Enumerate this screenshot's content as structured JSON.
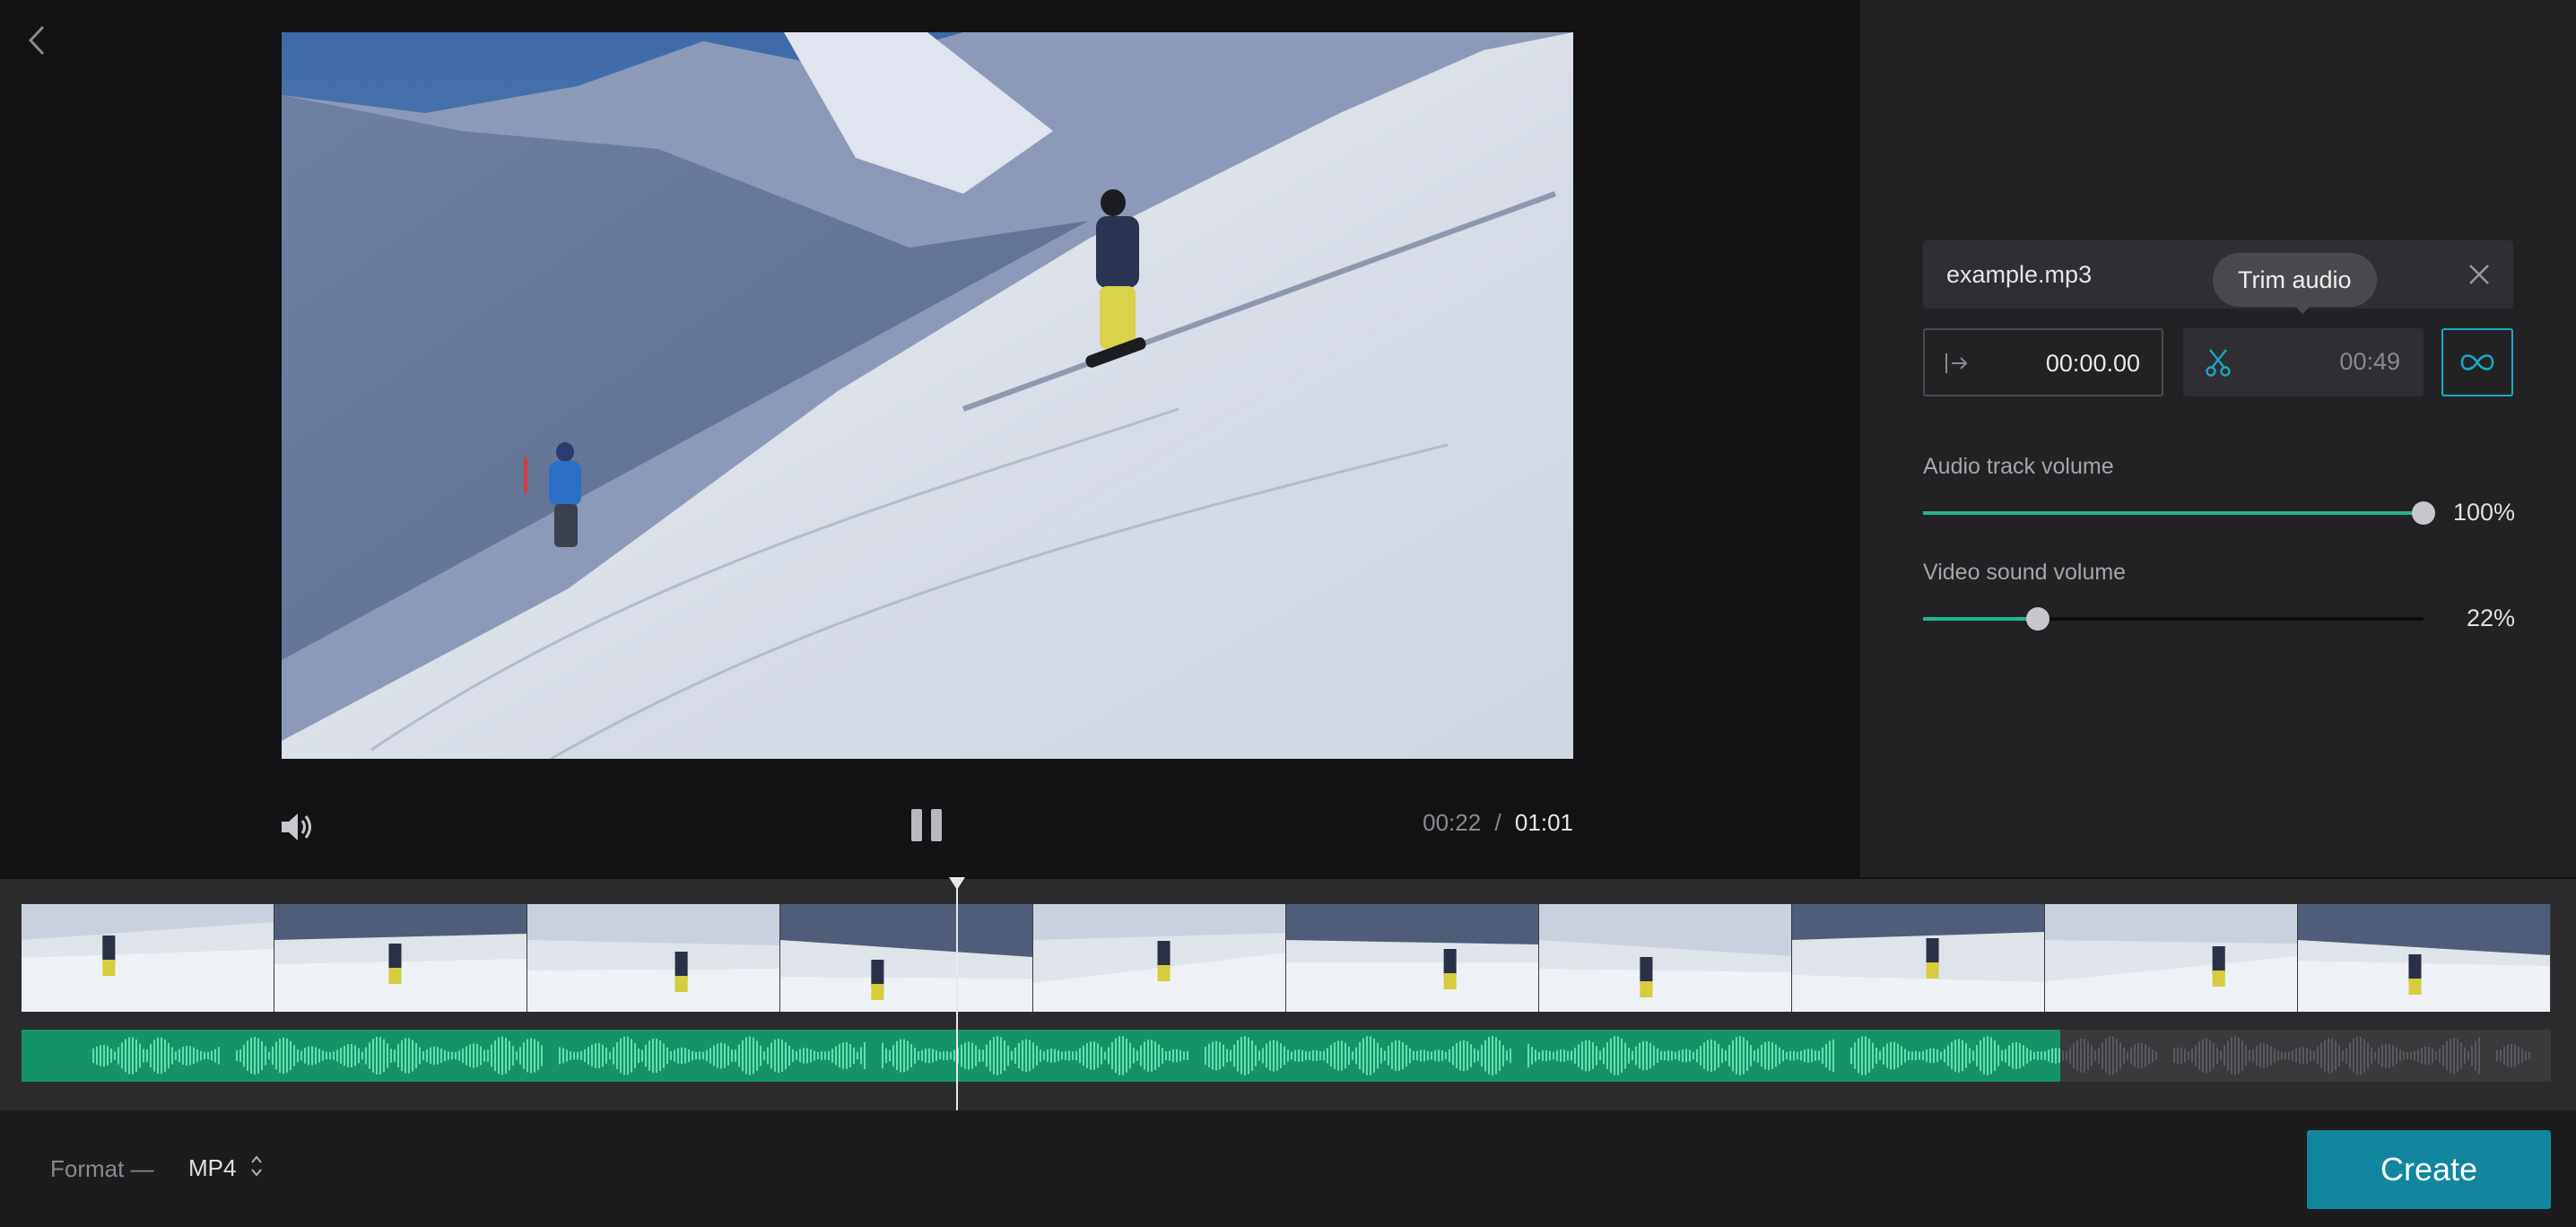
{
  "preview": {
    "current_time": "00:22",
    "separator": "/",
    "total_time": "01:01"
  },
  "audio": {
    "file_name": "example.mp3",
    "tooltip": "Trim audio",
    "start_time": "00:00.00",
    "trim_end": "00:49",
    "audio_volume_label": "Audio track volume",
    "audio_volume_pct": "100%",
    "audio_volume_value": 1.0,
    "video_volume_label": "Video sound volume",
    "video_volume_pct": "22%",
    "video_volume_value": 0.23
  },
  "timeline": {
    "thumbnail_count": 10,
    "playhead_fraction": 0.37,
    "audio_active_fraction": 0.806
  },
  "footer": {
    "format_label": "Format —",
    "format_value": "MP4",
    "create_label": "Create"
  },
  "colors": {
    "accent": "#12869f",
    "audio_green": "#159368",
    "slider_green": "#1fb58a",
    "loop_outline": "#1aa9c2"
  },
  "icons": [
    "back-chevron-icon",
    "speaker-icon",
    "pause-icon",
    "close-icon",
    "trim-start-icon",
    "scissors-icon",
    "loop-icon",
    "sort-arrows-icon"
  ]
}
